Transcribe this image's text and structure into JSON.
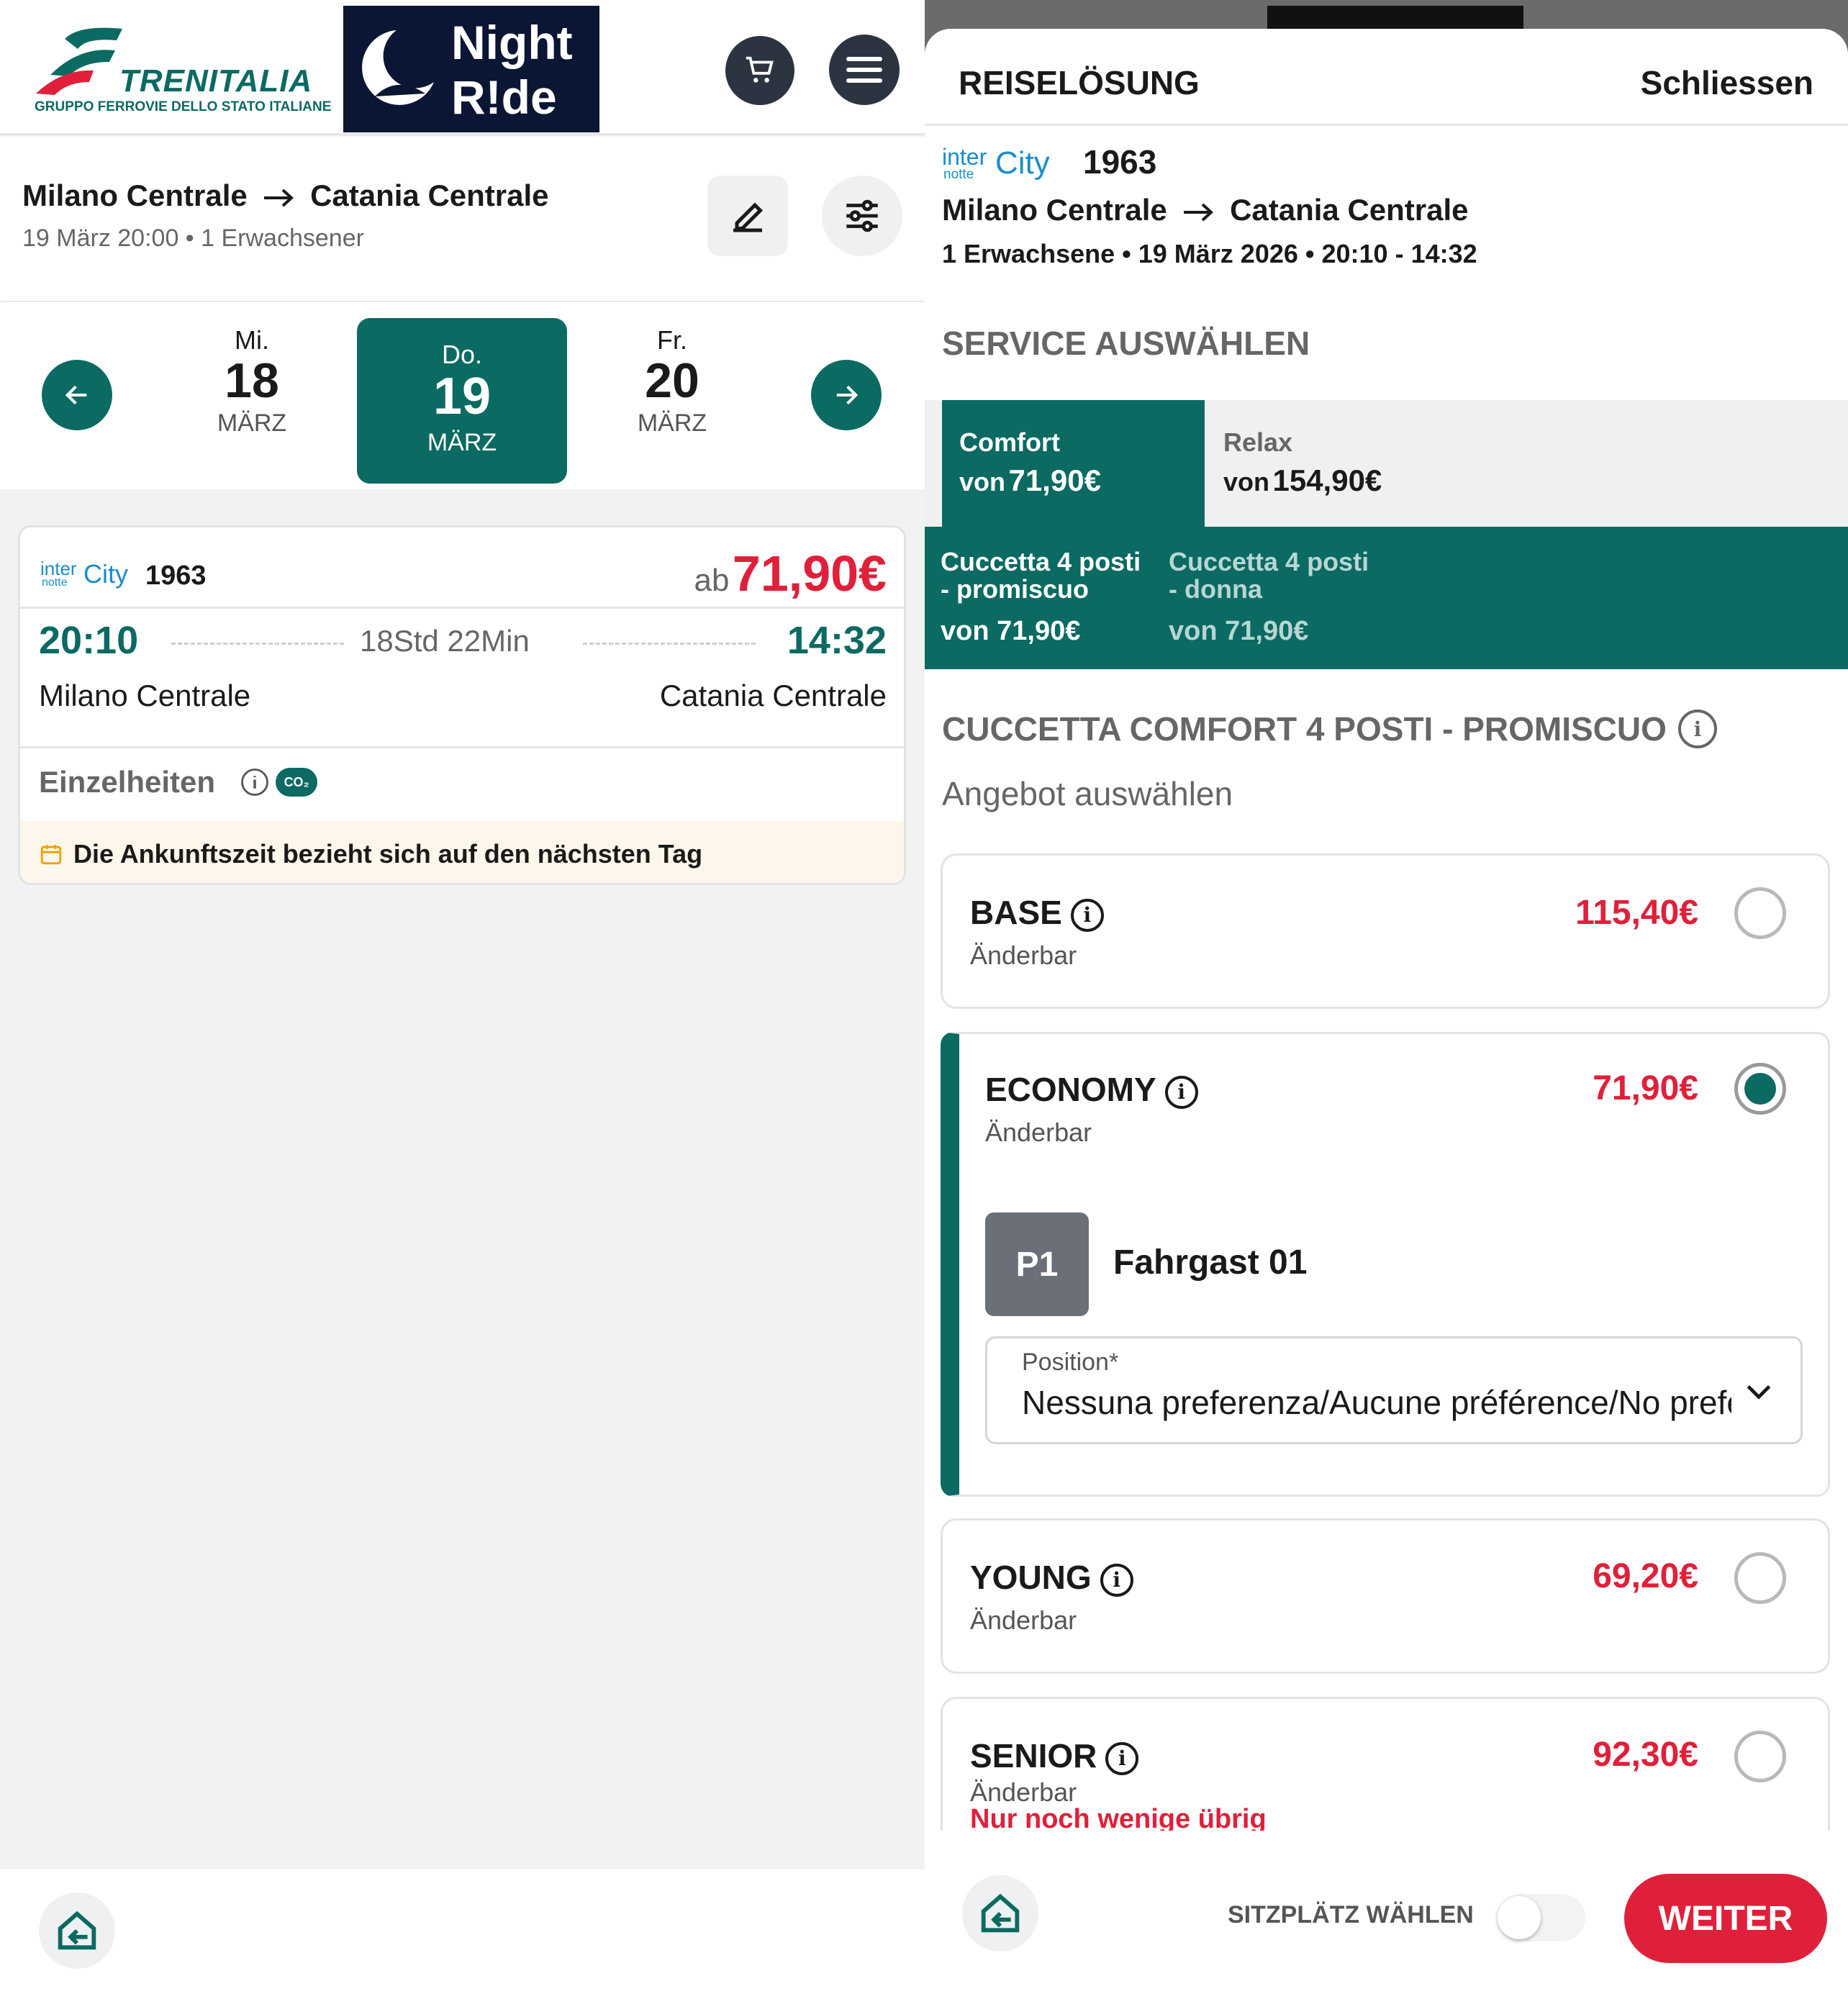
{
  "left": {
    "brand": {
      "name": "TRENITALIA",
      "group": "GRUPPO FERROVIE DELLO STATO ITALIANE",
      "partner_line1": "Night",
      "partner_line2": "R!de"
    },
    "search": {
      "from": "Milano Centrale",
      "to": "Catania Centrale",
      "meta": "19 März 20:00 • 1 Erwachsener"
    },
    "dates": [
      {
        "weekday": "Mi.",
        "day": "18",
        "month": "MÄRZ"
      },
      {
        "weekday": "Do.",
        "day": "19",
        "month": "MÄRZ"
      },
      {
        "weekday": "Fr.",
        "day": "20",
        "month": "MÄRZ"
      }
    ],
    "result": {
      "brand_small": "inter",
      "brand_sub": "notte",
      "brand_main": "City",
      "train_number": "1963",
      "price_prefix": "ab",
      "price": "71,90€",
      "dep_time": "20:10",
      "arr_time": "14:32",
      "duration": "18Std 22Min",
      "dep_station": "Milano Centrale",
      "arr_station": "Catania Centrale",
      "details_label": "Einzelheiten",
      "co2_label": "CO₂",
      "notice": "Die Ankunftszeit bezieht sich auf den nächsten Tag"
    }
  },
  "right": {
    "header": {
      "title": "REISELÖSUNG",
      "close": "Schliessen"
    },
    "train": {
      "brand_small": "inter",
      "brand_sub": "notte",
      "brand_main": "City",
      "number": "1963",
      "from": "Milano Centrale",
      "to": "Catania Centrale",
      "meta": "1 Erwachsene • 19 März 2026 • 20:10 - 14:32"
    },
    "service_heading": "SERVICE AUSWÄHLEN",
    "service_tabs": [
      {
        "name": "Comfort",
        "price_prefix": "von",
        "price": "71,90€"
      },
      {
        "name": "Relax",
        "price_prefix": "von",
        "price": "154,90€"
      }
    ],
    "sub_tabs": [
      {
        "line1": "Cuccetta 4 posti",
        "line2": "- promiscuo",
        "price": "von 71,90€"
      },
      {
        "line1": "Cuccetta 4 posti",
        "line2": "- donna",
        "price": "von 71,90€"
      }
    ],
    "section_title": "CUCCETTA COMFORT 4 POSTI - PROMISCUO",
    "section_sub": "Angebot auswählen",
    "info_glyph": "i",
    "offers": [
      {
        "name": "BASE",
        "sub": "Änderbar",
        "price": "115,40€"
      },
      {
        "name": "ECONOMY",
        "sub": "Änderbar",
        "price": "71,90€"
      },
      {
        "name": "YOUNG",
        "sub": "Änderbar",
        "price": "69,20€"
      },
      {
        "name": "SENIOR",
        "sub": "Änderbar",
        "price": "92,30€",
        "warning": "Nur noch wenige übrig"
      }
    ],
    "passenger": {
      "badge": "P1",
      "name": "Fahrgast 01",
      "position_label": "Position*",
      "position_value": "Nessuna preferenza/Aucune préférence/No preference"
    },
    "footer": {
      "seat_label": "SITZPLÄTZ WÄHLEN",
      "next": "WEITER"
    }
  },
  "colors": {
    "teal": "#0b6a62",
    "red": "#e0203a",
    "dark": "#2b3440",
    "navy": "#0a1633"
  },
  "icons": [
    "cart-icon",
    "menu-icon",
    "edit-icon",
    "filter-icon",
    "arrow-left-icon",
    "arrow-right-icon",
    "info-icon",
    "co2-icon",
    "calendar-icon",
    "home-exit-icon",
    "chevron-down-icon",
    "arrow-right-small-icon"
  ]
}
